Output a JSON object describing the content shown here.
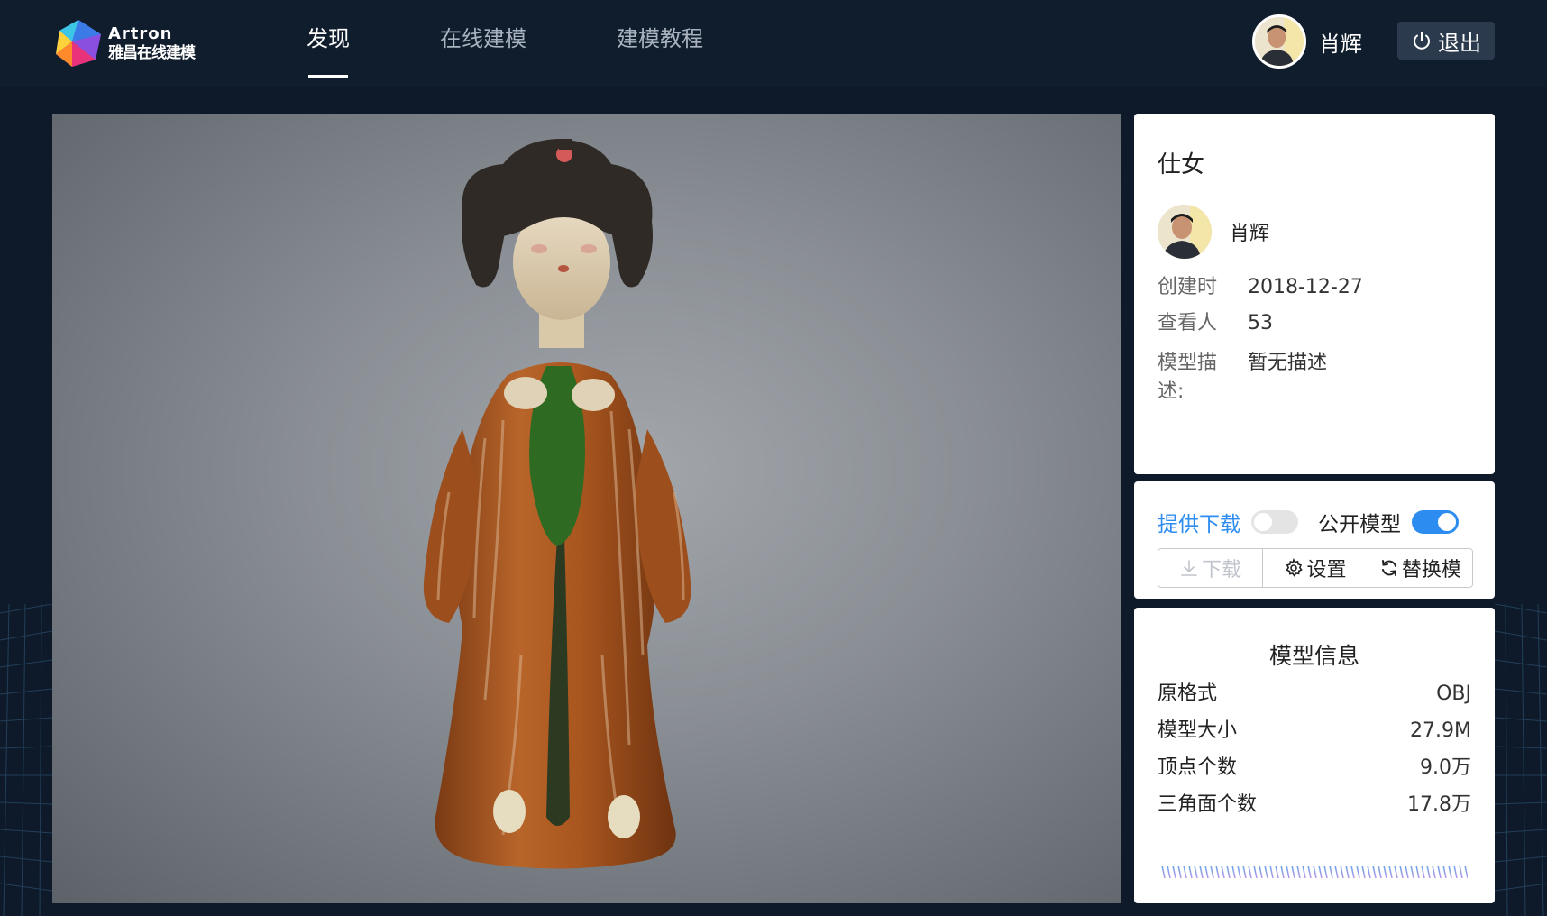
{
  "brand": {
    "name_en": "Artron",
    "name_cn": "雅昌在线建模"
  },
  "nav": {
    "items": [
      {
        "label": "发现",
        "active": true
      },
      {
        "label": "在线建模",
        "active": false
      },
      {
        "label": "建模教程",
        "active": false
      }
    ]
  },
  "user": {
    "name": "肖辉"
  },
  "logout": {
    "label": "退出"
  },
  "model": {
    "title": "仕女",
    "author": "肖辉",
    "created_label": "创建时",
    "created_value": "2018-12-27",
    "viewers_label": "查看人",
    "viewers_value": "53",
    "desc_label": "模型描述:",
    "desc_value": "暂无描述"
  },
  "actions": {
    "provide_download_label": "提供下载",
    "provide_download_on": false,
    "public_model_label": "公开模型",
    "public_model_on": true,
    "download_label": "下载",
    "settings_label": "设置",
    "replace_label": "替换模"
  },
  "stats": {
    "title": "模型信息",
    "rows": [
      {
        "label": "原格式",
        "value": "OBJ"
      },
      {
        "label": "模型大小",
        "value": "27.9M"
      },
      {
        "label": "顶点个数",
        "value": "9.0万"
      },
      {
        "label": "三角面个数",
        "value": "17.8万"
      }
    ]
  },
  "colors": {
    "header_bg": "#101d2d",
    "accent": "#2d8cf0",
    "panel_bg": "#ffffff"
  },
  "icons": [
    "logo-icon",
    "power-icon",
    "download-icon",
    "gear-icon",
    "refresh-icon"
  ]
}
